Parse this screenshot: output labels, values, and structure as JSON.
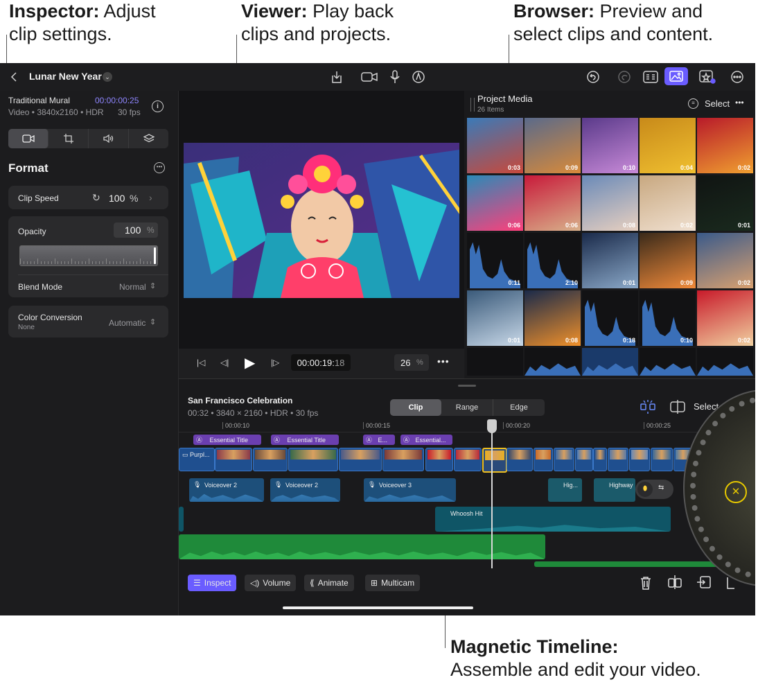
{
  "callouts": {
    "inspector": {
      "bold": "Inspector:",
      "text1": " Adjust",
      "text2": "clip settings."
    },
    "viewer": {
      "bold": "Viewer:",
      "text1": " Play back",
      "text2": "clips and projects."
    },
    "browser": {
      "bold": "Browser:",
      "text1": " Preview and",
      "text2": "select clips and content."
    },
    "timeline": {
      "bold": "Magnetic Timeline:",
      "text2": "Assemble and edit your video."
    }
  },
  "topbar": {
    "back_icon": "chevron-left-icon",
    "project_title": "Lunar New Year"
  },
  "inspector": {
    "clip_name": "Traditional Mural",
    "clip_timecode": "00:00:00:25",
    "clip_info": "Video • 3840x2160 • HDR",
    "fps": "30 fps",
    "section_title": "Format",
    "clip_speed_label": "Clip Speed",
    "clip_speed_value": "100",
    "clip_speed_unit": "%",
    "opacity_label": "Opacity",
    "opacity_value": "100",
    "opacity_unit": "%",
    "opacity_level": 1.0,
    "blend_label": "Blend Mode",
    "blend_value": "Normal",
    "color_label": "Color Conversion",
    "color_sub": "None",
    "color_value": "Automatic"
  },
  "viewer": {
    "timecode_main": "00:00:19:",
    "timecode_frames": "18",
    "zoom_value": "26",
    "zoom_unit": "%"
  },
  "browser": {
    "title": "Project Media",
    "count": "26 Items",
    "select_label": "Select",
    "durations": [
      "0:03",
      "0:09",
      "0:10",
      "0:04",
      "0:02",
      "0:06",
      "0:06",
      "0:08",
      "0:02",
      "0:01",
      "0:11",
      "2:10",
      "0:01",
      "0:09",
      "0:02",
      "0:01",
      "0:08",
      "0:18",
      "0:10",
      "0:02"
    ]
  },
  "timeline": {
    "project_name": "San Francisco Celebration",
    "project_info": "00:32 • 3840 × 2160 • HDR • 30 fps",
    "modes": [
      "Clip",
      "Range",
      "Edge"
    ],
    "select_label": "Select",
    "ruler": [
      "00:00:10",
      "00:00:15",
      "00:00:20",
      "00:00:25"
    ],
    "titles": [
      "Essential Title",
      "Essential Title",
      "E...",
      "Essential..."
    ],
    "first_clip": "Purpl...",
    "voiceovers": [
      "Voiceover 2",
      "Voiceover 2",
      "Voiceover 3"
    ],
    "sfx": [
      "Hig...",
      "Highway"
    ],
    "whoosh": "Whoosh Hit",
    "buttons": {
      "inspect": "Inspect",
      "volume": "Volume",
      "animate": "Animate",
      "multicam": "Multicam"
    }
  },
  "colors": {
    "accent": "#6a5cff",
    "timecode": "#8f86ff",
    "video_clip": "#1f4f8f",
    "title_clip": "#6b3fb0",
    "music": "#1f8a3a"
  }
}
